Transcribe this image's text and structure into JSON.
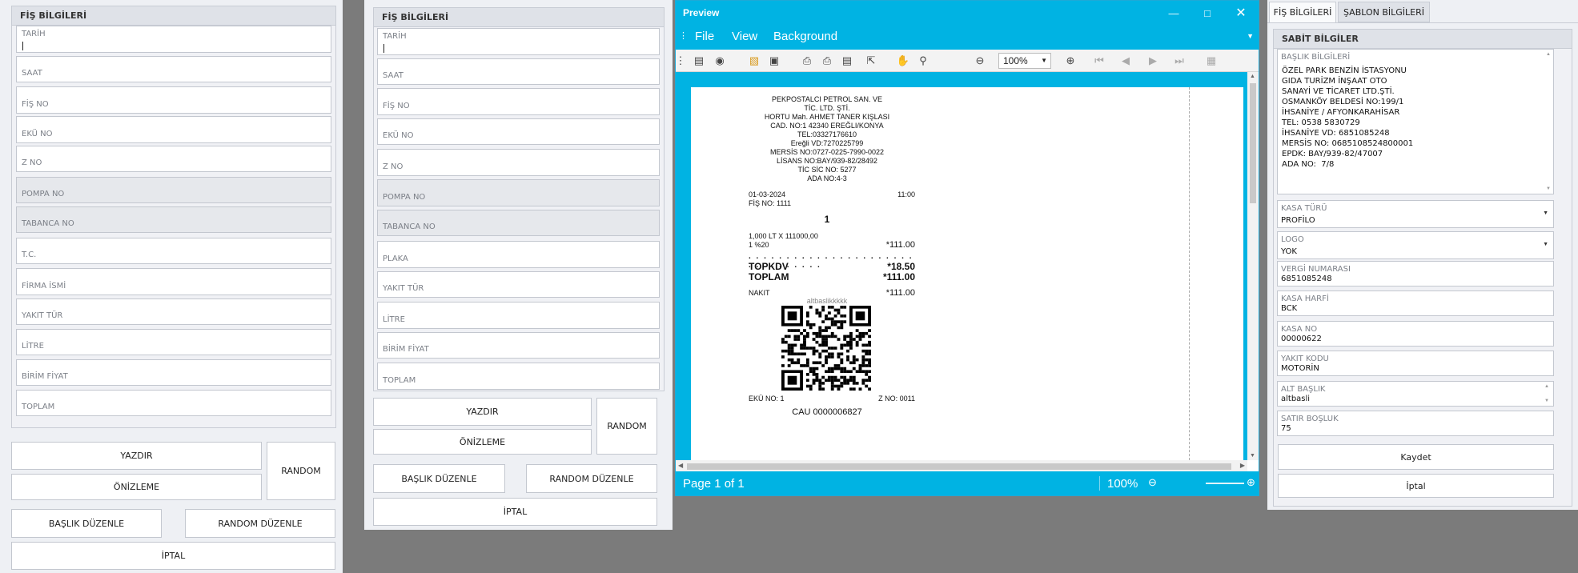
{
  "left_form": {
    "title": "FİŞ BİLGİLERİ",
    "fields": [
      {
        "label": "TARİH"
      },
      {
        "label": "SAAT"
      },
      {
        "label": "FİŞ NO"
      },
      {
        "label": "EKÜ NO"
      },
      {
        "label": "Z NO"
      },
      {
        "label": "POMPA NO"
      },
      {
        "label": "TABANCA NO"
      },
      {
        "label": "T.C."
      },
      {
        "label": "FİRMA İSMİ"
      },
      {
        "label": "YAKIT TÜR"
      },
      {
        "label": "LİTRE"
      },
      {
        "label": "BİRİM FİYAT"
      },
      {
        "label": "TOPLAM"
      }
    ],
    "buttons": {
      "print": "YAZDIR",
      "preview": "ÖNİZLEME",
      "random": "RANDOM",
      "edit_header": "BAŞLIK DÜZENLE",
      "edit_random": "RANDOM DÜZENLE",
      "cancel": "İPTAL"
    }
  },
  "mid_form": {
    "title": "FİŞ BİLGİLERİ",
    "fields": [
      {
        "label": "TARİH"
      },
      {
        "label": "SAAT"
      },
      {
        "label": "FİŞ NO"
      },
      {
        "label": "EKÜ NO"
      },
      {
        "label": "Z NO"
      },
      {
        "label": "POMPA NO"
      },
      {
        "label": "TABANCA NO"
      },
      {
        "label": "PLAKA"
      },
      {
        "label": "YAKIT TÜR"
      },
      {
        "label": "LİTRE"
      },
      {
        "label": "BİRİM FİYAT"
      },
      {
        "label": "TOPLAM"
      }
    ],
    "buttons": {
      "print": "YAZDIR",
      "preview": "ÖNİZLEME",
      "random": "RANDOM",
      "edit_header": "BAŞLIK DÜZENLE",
      "edit_random": "RANDOM DÜZENLE",
      "cancel": "İPTAL"
    }
  },
  "preview": {
    "title": "Preview",
    "menu": {
      "file": "File",
      "view": "View",
      "background": "Background"
    },
    "zoom": "100%",
    "status": {
      "page": "Page 1 of 1",
      "zoom": "100%"
    },
    "receipt": {
      "header_lines": [
        "PEKPOSTALCI PETROL SAN. VE",
        "TİC. LTD. ŞTİ.",
        "HORTU Mah. AHMET TANER KIŞLASI",
        "CAD. NO:1 42340 EREĞLI/KONYA",
        "TEL:03327176610",
        "Ereğli VD:7270225799",
        "MERSİS NO:0727-0225-7990-0022",
        "LİSANS NO:BAY/939-82/28492",
        "TİC SİC NO: 5277",
        "ADA NO:4-3"
      ],
      "date": "01-03-2024",
      "time": "11:00",
      "receipt_no": "FİŞ NO: 1111",
      "pump": "1",
      "qty_line": "1,000 LT X 111000,00",
      "vat_rate": "1 %20",
      "item_amount": "*111.00",
      "topkdv_label": "TOPKDV",
      "topkdv_value": "*18.50",
      "total_label": "TOPLAM",
      "total_value": "*111.00",
      "cash_label": "NAKIT",
      "cash_value": "*111.00",
      "subtitle": "altbaslikkkkk",
      "eku": "EKÜ NO: 1",
      "z": "Z NO: 0011",
      "serial": "CAU 0000006827"
    }
  },
  "right_panel": {
    "tabs": [
      "FİŞ BİLGİLERİ",
      "ŞABLON BİLGİLERİ"
    ],
    "group_title": "SABİT BİLGİLER",
    "header_label": "BAŞLIK BİLGİLERİ",
    "header_text": "ÖZEL PARK BENZİN İSTASYONU\nGIDA TURİZM İNŞAAT OTO\nSANAYİ VE TİCARET LTD.ŞTİ.\nOSMANKÖY BELDESİ NO:199/1\nİHSANİYE / AFYONKARAHİSAR\nTEL: 0538 5830729\nİHSANİYE VD: 6851085248\nMERSİS NO: 0685108524800001\nEPDK: BAY/939-82/47007\nADA NO:  7/8",
    "fields": [
      {
        "label": "KASA TÜRÜ",
        "value": "PROFİLO"
      },
      {
        "label": "LOGO",
        "value": "YOK"
      },
      {
        "label": "VERGİ NUMARASI",
        "value": "6851085248"
      },
      {
        "label": "KASA HARFİ",
        "value": "BCK"
      },
      {
        "label": "KASA NO",
        "value": "00000622"
      },
      {
        "label": "YAKIT KODU",
        "value": "MOTORİN"
      },
      {
        "label": "ALT BAŞLIK",
        "value": "altbasli"
      },
      {
        "label": "SATIR BOŞLUK",
        "value": "75"
      }
    ],
    "buttons": {
      "save": "Kaydet",
      "cancel": "İptal"
    }
  }
}
